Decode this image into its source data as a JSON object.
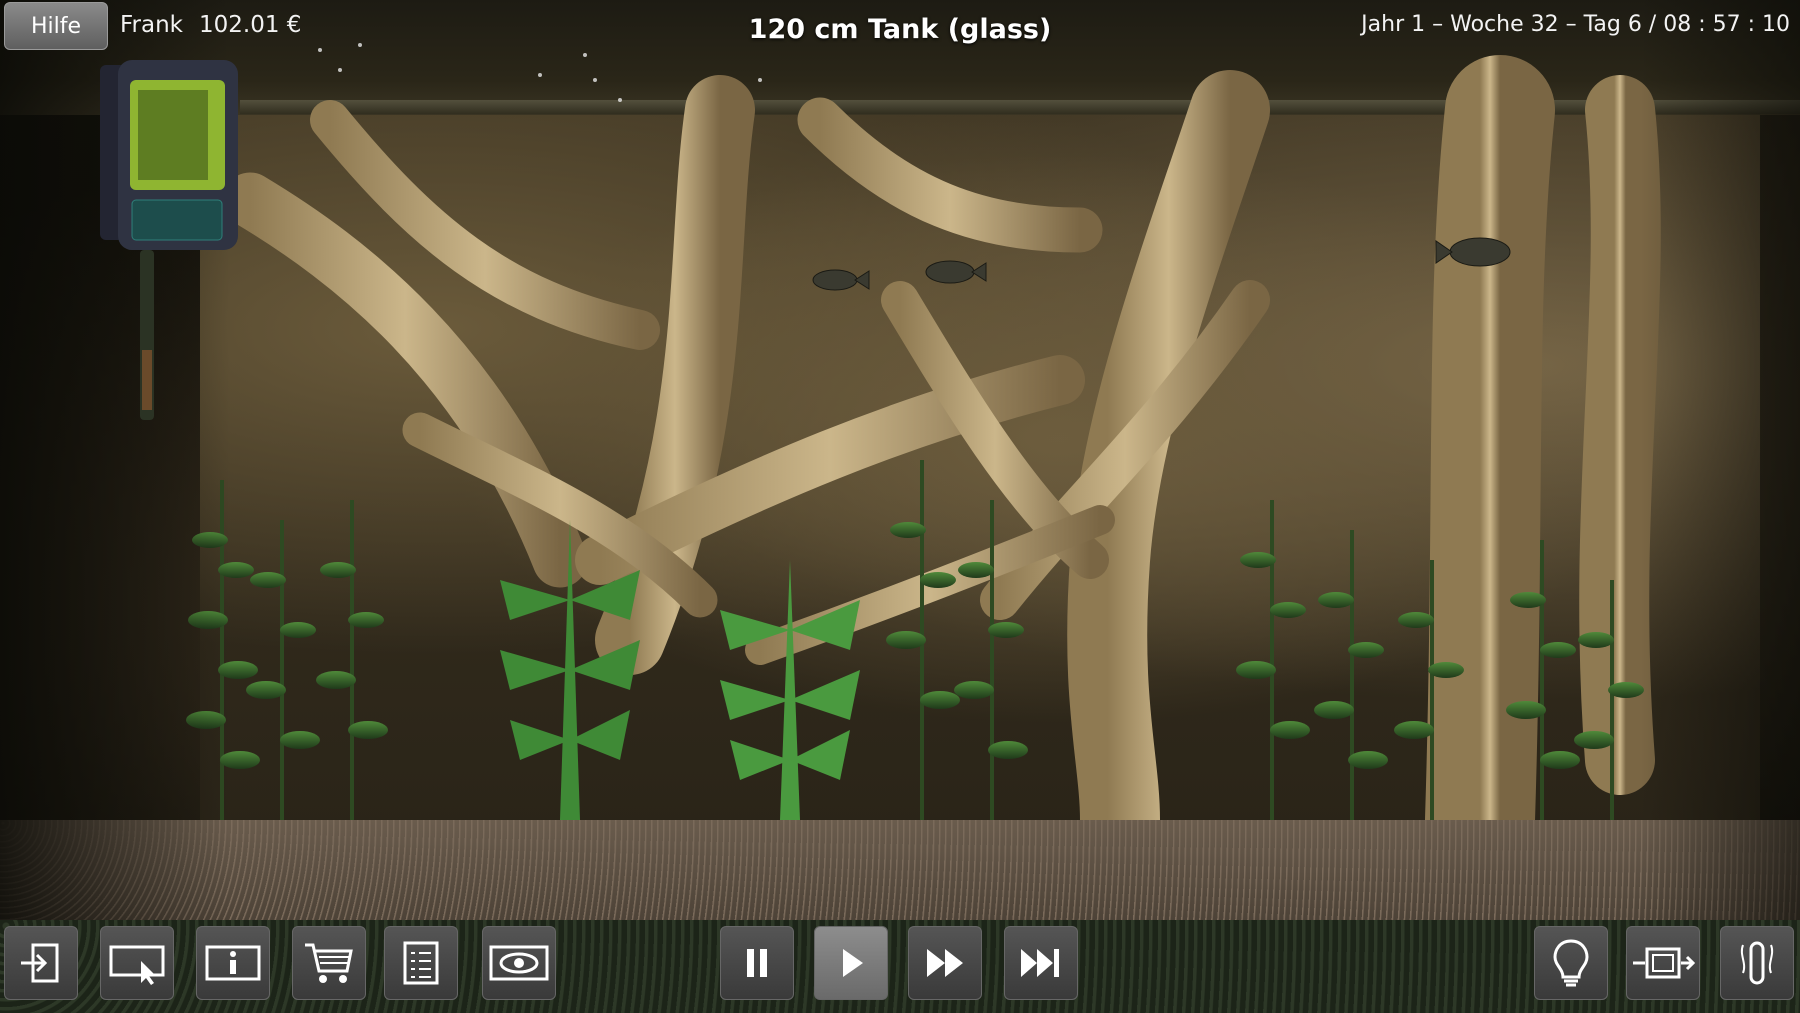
{
  "header": {
    "help_label": "Hilfe",
    "player_name": "Frank",
    "money": "102.01 €",
    "tank_title": "120 cm Tank (glass)",
    "game_date": "Jahr 1 – Woche 32 – Tag 6  /  08 : 57 : 10"
  },
  "toolbar": {
    "left_buttons": [
      {
        "icon": "exit-icon"
      },
      {
        "icon": "select-pointer-icon"
      },
      {
        "icon": "info-icon"
      },
      {
        "icon": "shop-cart-icon"
      },
      {
        "icon": "checklist-icon"
      },
      {
        "icon": "eye-icon"
      }
    ],
    "speed_buttons": [
      {
        "icon": "pause-icon"
      },
      {
        "icon": "play-icon",
        "active": true
      },
      {
        "icon": "fast-forward-icon"
      },
      {
        "icon": "skip-forward-icon"
      }
    ],
    "right_buttons": [
      {
        "icon": "light-bulb-icon"
      },
      {
        "icon": "filter-icon"
      },
      {
        "icon": "heater-icon"
      }
    ]
  },
  "colors": {
    "hud_text": "#f3f3f3",
    "button_bg": "#4a4a4a",
    "filter_green": "#8fb531"
  }
}
